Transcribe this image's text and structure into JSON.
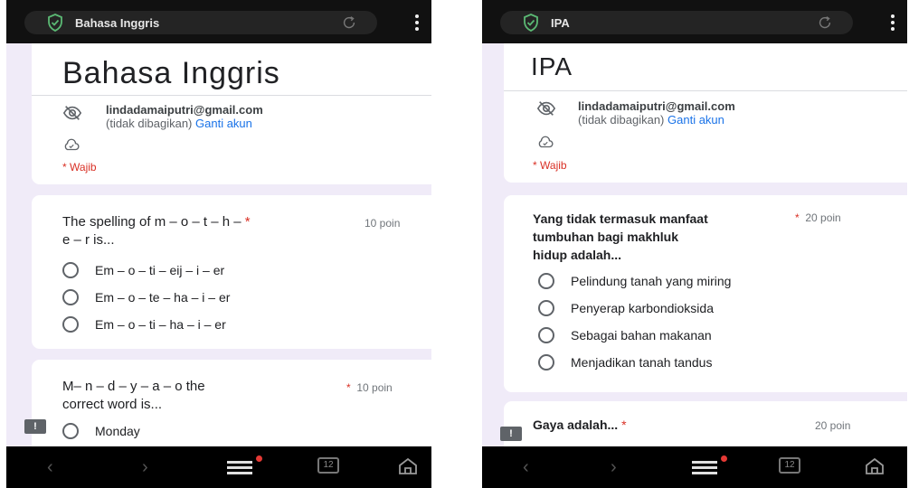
{
  "colors": {
    "accent": "#673ab7",
    "required": "#d93025",
    "link": "#1a73e8",
    "background": "#f0ebf8"
  },
  "left": {
    "tab_title": "Bahasa Inggris",
    "form_title": "Bahasa Inggris",
    "account": {
      "email": "lindadamaiputri@gmail.com",
      "not_shared": "(tidak dibagikan)",
      "switch_link": "Ganti akun"
    },
    "required_label": "Wajib",
    "q1": {
      "text_line1": "The spelling of m – o – t – h –",
      "text_line2": "e – r is...",
      "points": "10 poin",
      "options": [
        "Em – o – ti – eij – i – er",
        "Em – o – te – ha – i – er",
        "Em – o – ti – ha – i – er"
      ]
    },
    "q2": {
      "text_line1": "M– n – d – y – a – o the",
      "text_line2": "correct word is...",
      "points": "10 poin",
      "options": [
        "Monday"
      ]
    }
  },
  "right": {
    "tab_title": "IPA",
    "form_title": "IPA",
    "account": {
      "email": "lindadamaiputri@gmail.com",
      "not_shared": "(tidak dibagikan)",
      "switch_link": "Ganti akun"
    },
    "required_label": "Wajib",
    "q1": {
      "text_line1": "Yang tidak termasuk manfaat",
      "text_line2": "tumbuhan bagi makhluk",
      "text_line3": "hidup adalah...",
      "points": "20 poin",
      "options": [
        "Pelindung tanah yang miring",
        "Penyerap karbondioksida",
        "Sebagai bahan makanan",
        "Menjadikan tanah tandus"
      ]
    },
    "q2": {
      "text": "Gaya adalah...",
      "points": "20 poin"
    }
  },
  "icons": {
    "shield": "shield-check-icon",
    "reload": "reload-icon",
    "menu": "kebab-menu-icon",
    "hidden": "eye-off-icon",
    "cloud": "cloud-check-icon",
    "feedback": "feedback-icon",
    "back": "back-arrow-icon",
    "forward": "forward-arrow-icon",
    "hamburger": "hamburger-menu-icon",
    "tabs": "tabs-icon",
    "home": "home-icon"
  },
  "nav": {
    "tab_count": "12"
  }
}
